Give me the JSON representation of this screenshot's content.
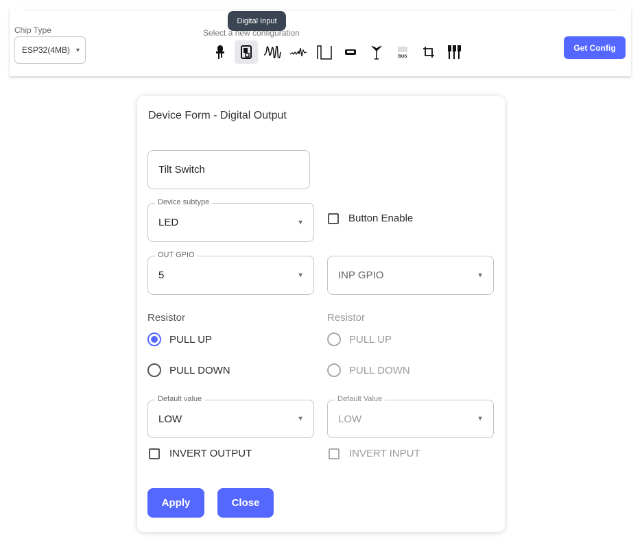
{
  "header": {
    "chip_type_label": "Chip Type",
    "chip_type_value": "ESP32(4MB)",
    "config_hint": "Select a new configuration",
    "tooltip": "Digital Input",
    "get_config_label": "Get Config",
    "toolbar_icons": [
      "led-icon",
      "digital-input-icon",
      "analog-signal-icon",
      "pwm-signal-icon",
      "pulse-icon",
      "display-icon",
      "antenna-icon",
      "bus-icon",
      "crop-icon",
      "multi-pin-icon"
    ],
    "bus_icon_text": "BUS"
  },
  "form": {
    "title": "Device Form - Digital Output",
    "name_value": "Tilt Switch",
    "subtype_label": "Device subtype",
    "subtype_value": "LED",
    "button_enable_label": "Button Enable",
    "out_gpio_label": "OUT GPIO",
    "out_gpio_value": "5",
    "inp_gpio_placeholder": "INP GPIO",
    "left": {
      "resistor_label": "Resistor",
      "pull_up": "PULL UP",
      "pull_down": "PULL DOWN",
      "default_label": "Default value",
      "default_value": "LOW",
      "invert_label": "INVERT OUTPUT"
    },
    "right": {
      "resistor_label": "Resistor",
      "pull_up": "PULL UP",
      "pull_down": "PULL DOWN",
      "default_label": "Default Value",
      "default_value": "LOW",
      "invert_label": "INVERT INPUT"
    },
    "apply_label": "Apply",
    "close_label": "Close"
  },
  "colors": {
    "accent": "#5468ff",
    "tooltip_bg": "#3b4452"
  }
}
